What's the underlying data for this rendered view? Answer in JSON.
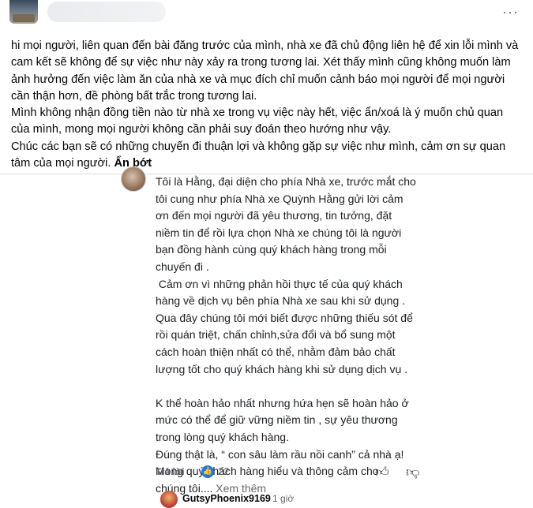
{
  "post": {
    "more_label": "···",
    "text_lines": [
      "hi mọi người, liên quan đến bài đăng trước của mình, nhà xe đã chủ động liên hệ để xin lỗi mình và",
      "cam kết sẽ không để sự việc như này xảy ra trong tương lai. Xét thấy mình cũng không muốn làm",
      "ảnh hưởng đến việc làm ăn của nhà xe và mục đích chỉ muốn cảnh báo mọi người để mọi người",
      "cần thận hơn, đề phòng bất trắc trong tương lai.",
      "Mình không nhận đồng tiền nào từ nhà xe trong vụ việc này hết, việc ẩn/xoá là ý muốn chủ quan",
      "của mình, mong mọi người không cần phải suy đoán theo hướng như vậy.",
      "Chúc các bạn sẽ có những chuyến đi thuận lợi và không gặp sự việc như mình, cảm ơn sự quan"
    ],
    "last_line": "tâm của mọi người.",
    "see_less": "Ẩn bớt"
  },
  "comment": {
    "lines": [
      "Tôi là Hằng, đại diện cho phía Nhà xe, trước mắt cho",
      "tôi cung như phía Nhà xe Quỳnh Hằng gửi lời cảm",
      "ơn đến mọi người đã yêu thương, tin tưởng, đặt",
      "niềm tin để rồi lựa chọn Nhà xe chúng tôi là người",
      "bạn đồng hành cùng quý khách hàng trong mỗi",
      "chuyến đi .",
      " Cảm ơn vì những phản hồi thực tế của quý khách",
      "hàng về dịch vụ bên phía Nhà xe sau khi sử dụng .",
      "Qua đây chúng tôi mới biết được những thiếu sót để",
      "rồi quán triệt, chấn chỉnh,sửa đổi và bổ sung một",
      "cách hoàn thiện nhất có thể, nhằm đảm bảo chất",
      "lượng tốt cho quý khách hàng khi sử dụng dịch vụ .",
      "",
      "K thể hoàn hảo nhất nhưng hứa hẹn sẽ hoàn hảo ở",
      "mức có thể để giữ vững niềm tin , sự yêu thương",
      "trong lòng quý khách hàng.",
      "Đúng thật là, “ con sâu làm rầu nồi canh” cả nhà ạ!",
      "Mong quý khách hàng hiểu và thông cảm cho"
    ],
    "last_line": "chúng tôi....",
    "see_more": "Xem thêm",
    "reply_label": "Trả lời",
    "reaction_count": "22",
    "reaction_icon": "like-reaction-icon"
  },
  "reply_preview": {
    "name": "GutsyPhoenix9169",
    "time": "1 giờ"
  },
  "colors": {
    "accent": "#1877f2",
    "secondary_text": "#65676b",
    "divider": "#dcdde0"
  }
}
